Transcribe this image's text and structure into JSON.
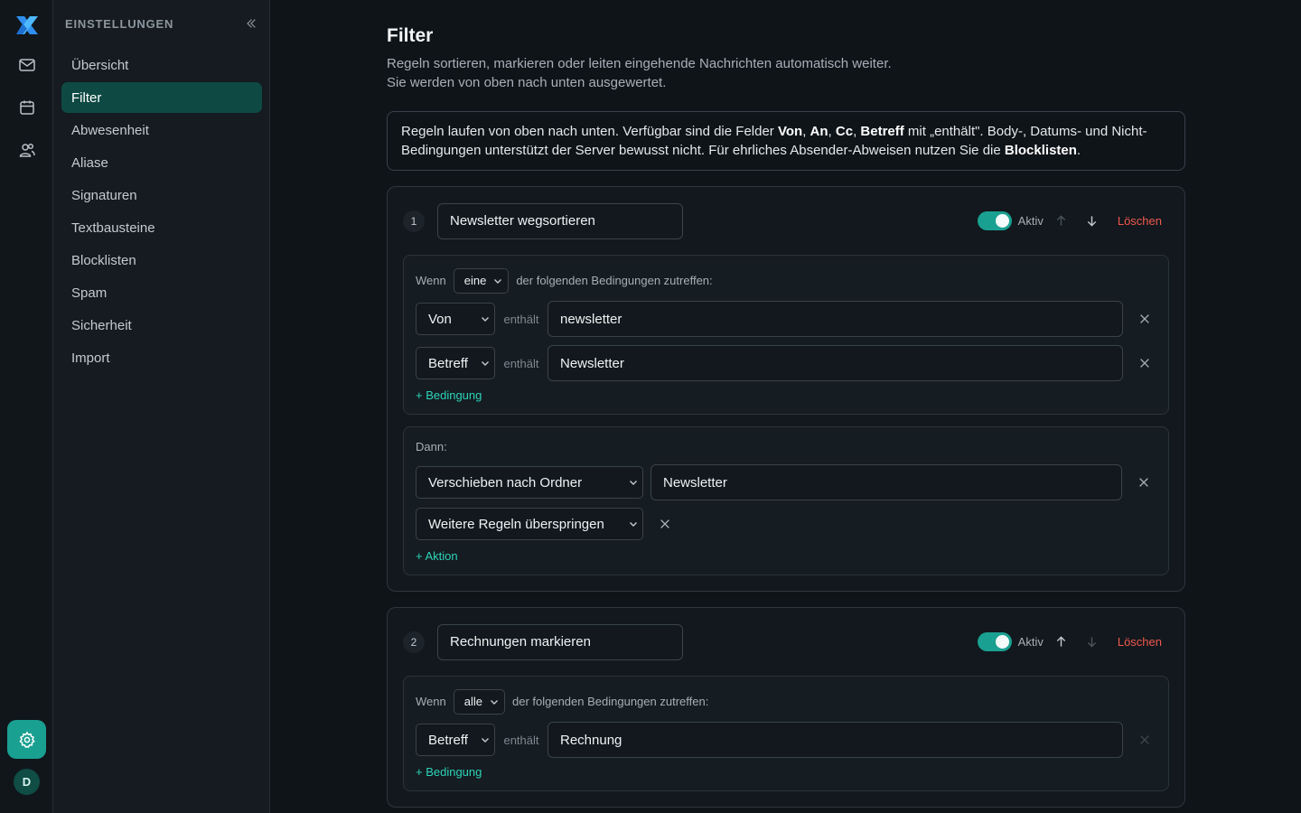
{
  "sidebar": {
    "title": "EINSTELLUNGEN",
    "items": [
      "Übersicht",
      "Filter",
      "Abwesenheit",
      "Aliase",
      "Signaturen",
      "Textbausteine",
      "Blocklisten",
      "Spam",
      "Sicherheit",
      "Import"
    ],
    "active": "Filter"
  },
  "user": {
    "initial": "D"
  },
  "page": {
    "title": "Filter",
    "subtitle_1": "Regeln sortieren, markieren oder leiten eingehende Nachrichten automatisch weiter.",
    "subtitle_2": "Sie werden von oben nach unten ausgewertet."
  },
  "notice": {
    "t1": "Regeln laufen von oben nach unten. Verfügbar sind die Felder ",
    "f1": "Von",
    "s1": ", ",
    "f2": "An",
    "s2": ", ",
    "f3": "Cc",
    "s3": ", ",
    "f4": "Betreff",
    "t2": " mit „enthält\". Body-, Datums- und Nicht-Bedingungen unterstützt der Server bewusst nicht. Für ehrliches Absender-Abweisen nutzen Sie die ",
    "link": "Blocklisten",
    "t3": "."
  },
  "labels": {
    "active": "Aktiv",
    "delete": "Löschen",
    "when": "Wenn",
    "conditions_suffix": "der folgenden Bedingungen zutreffen:",
    "contains": "enthält",
    "then": "Dann:",
    "add_condition": "+ Bedingung",
    "add_action": "+ Aktion"
  },
  "rules": [
    {
      "number": "1",
      "name": "Newsletter wegsortieren",
      "match": "eine",
      "conditions": [
        {
          "field": "Von",
          "value": "newsletter"
        },
        {
          "field": "Betreff",
          "value": "Newsletter"
        }
      ],
      "actions": [
        {
          "type": "Verschieben nach Ordner",
          "value": "Newsletter"
        },
        {
          "type": "Weitere Regeln überspringen"
        }
      ]
    },
    {
      "number": "2",
      "name": "Rechnungen markieren",
      "match": "alle",
      "conditions": [
        {
          "field": "Betreff",
          "value": "Rechnung"
        }
      ]
    }
  ],
  "colors": {
    "accent": "#1aa091",
    "danger": "#f0584f",
    "link": "#2dd4b8"
  }
}
